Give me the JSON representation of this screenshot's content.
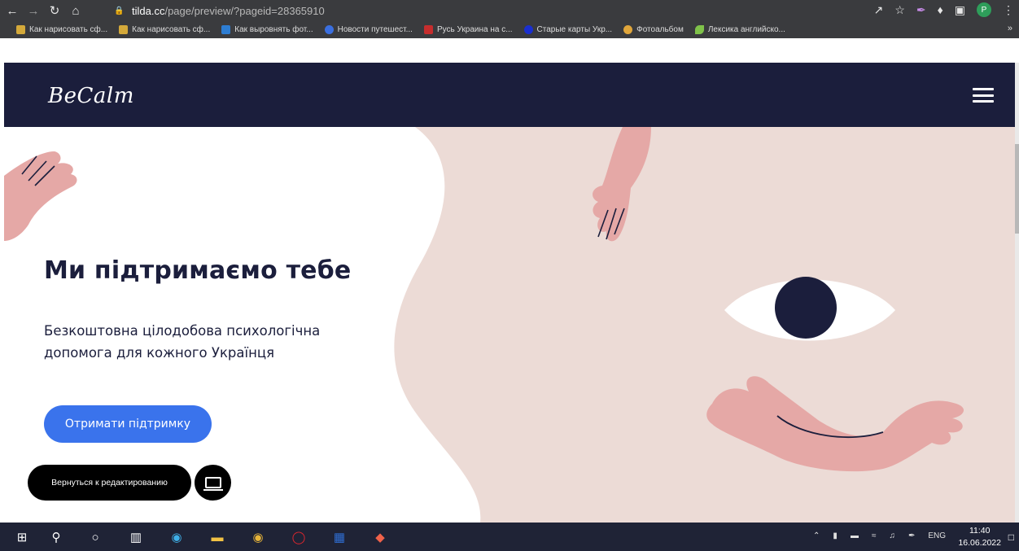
{
  "browser": {
    "url_host": "tilda.cc",
    "url_path": "/page/preview/?pageid=28365910",
    "profile_initial": "P",
    "bookmarks": [
      {
        "label": "Как нарисовать сф...",
        "color": "#d4a93a"
      },
      {
        "label": "Как нарисовать сф...",
        "color": "#d4a93a"
      },
      {
        "label": "Как выровнять фот...",
        "color": "#2d7dd2"
      },
      {
        "label": "Новости путешест...",
        "color": "#3a6fe0"
      },
      {
        "label": "Русь Украина на с...",
        "color": "#c62d2d"
      },
      {
        "label": "Старые карты Укр...",
        "color": "#1a2fd0"
      },
      {
        "label": "Фотоальбом",
        "color": "#e0a63b"
      },
      {
        "label": "Лексика английско...",
        "color": "#7fc24a"
      }
    ],
    "more_bookmarks": "»"
  },
  "site": {
    "logo": "BeCalm",
    "hero_title": "Ми підтримаємо тебе",
    "hero_subtitle": "Безкоштовна цілодобова психологічна допомога для кожного Українця",
    "cta_label": "Отримати підтримку",
    "edit_label": "Вернуться к редактированию"
  },
  "colors": {
    "header_bg": "#1b1e3c",
    "hero_bg": "#ecdbd6",
    "accent": "#3a73ec",
    "hand": "#e5a8a6"
  },
  "taskbar": {
    "language": "ENG",
    "time": "11:40",
    "date": "16.06.2022"
  }
}
